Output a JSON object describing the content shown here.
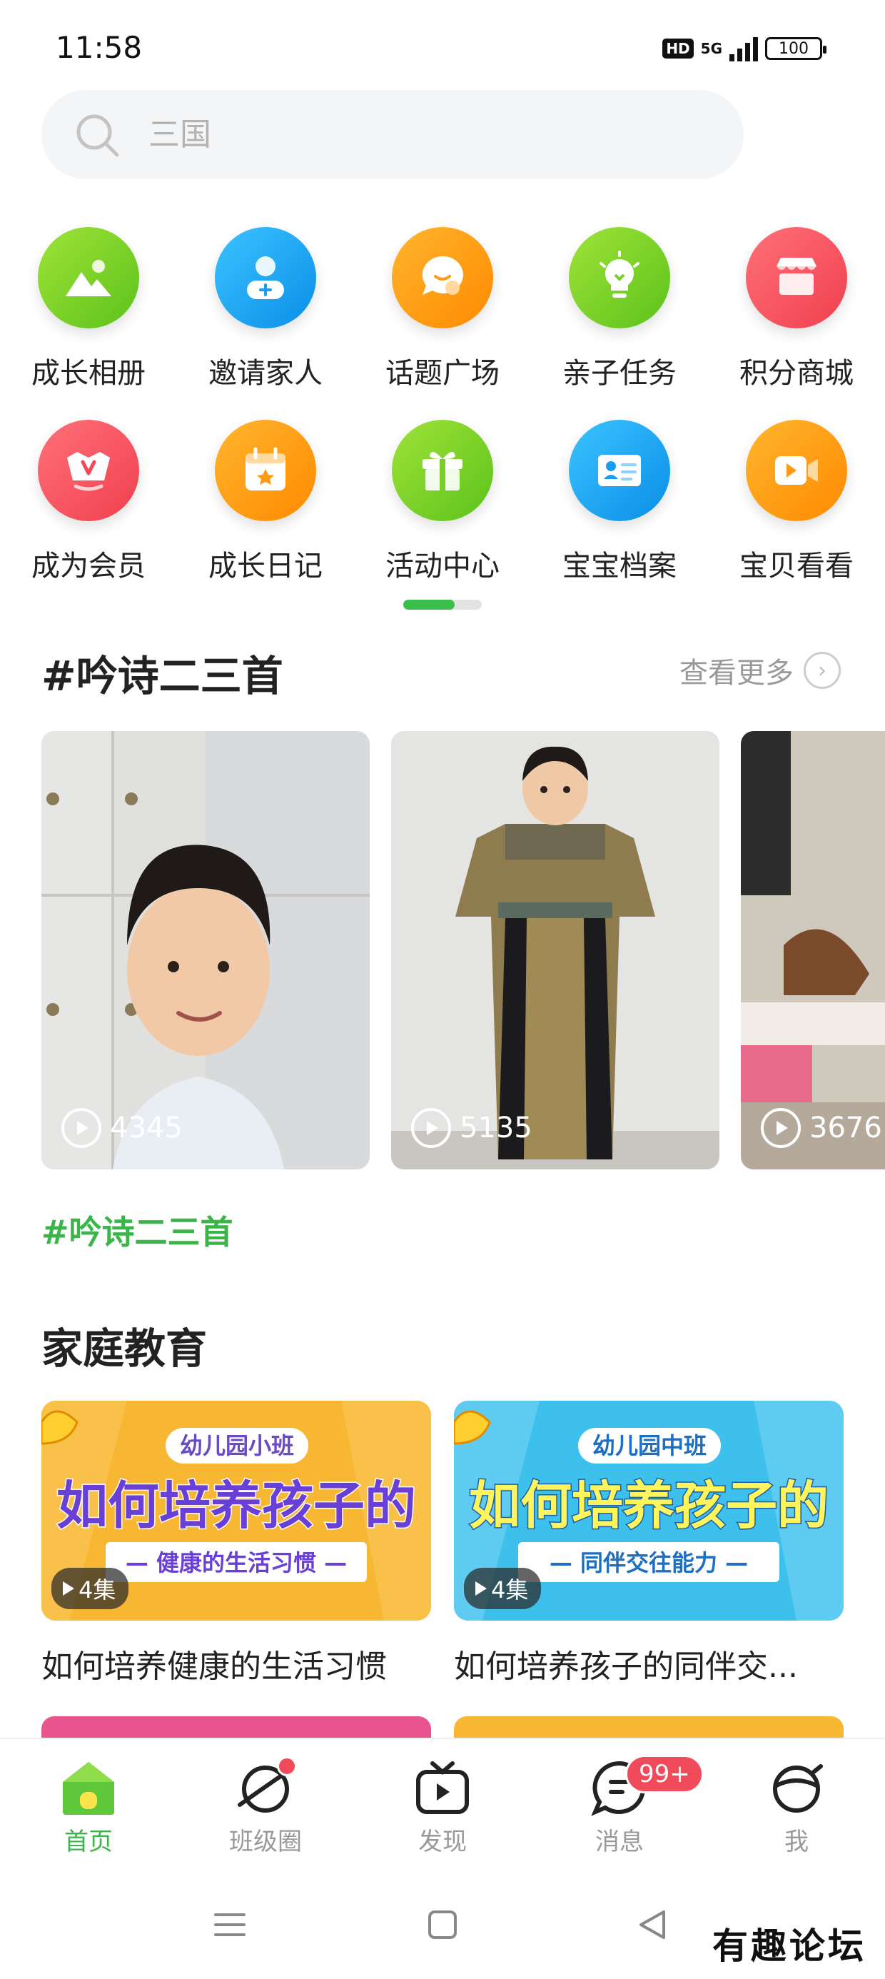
{
  "status": {
    "time": "11:58",
    "hd": "HD",
    "network": "5G",
    "battery": "100"
  },
  "search": {
    "placeholder": "三国"
  },
  "quick_grid": [
    {
      "label": "成长相册",
      "icon": "photo-album-icon",
      "color": "#7ed321"
    },
    {
      "label": "邀请家人",
      "icon": "invite-person-icon",
      "color": "#1aa7f5"
    },
    {
      "label": "话题广场",
      "icon": "chat-bubble-icon",
      "color": "#ff9f0a"
    },
    {
      "label": "亲子任务",
      "icon": "lightbulb-icon",
      "color": "#7ed321"
    },
    {
      "label": "积分商城",
      "icon": "store-icon",
      "color": "#f7525f"
    },
    {
      "label": "成为会员",
      "icon": "vip-crown-icon",
      "color": "#f7525f"
    },
    {
      "label": "成长日记",
      "icon": "calendar-star-icon",
      "color": "#ff9f0a"
    },
    {
      "label": "活动中心",
      "icon": "gift-icon",
      "color": "#7ed321"
    },
    {
      "label": "宝宝档案",
      "icon": "profile-card-icon",
      "color": "#1aa7f5"
    },
    {
      "label": "宝贝看看",
      "icon": "video-camera-icon",
      "color": "#ff9f0a"
    }
  ],
  "section1": {
    "title": "#吟诗二三首",
    "see_more": "查看更多",
    "videos": [
      {
        "plays": "4345"
      },
      {
        "plays": "5135"
      },
      {
        "plays": "3676"
      }
    ],
    "hashtag": "#吟诗二三首"
  },
  "section2": {
    "title": "家庭教育",
    "courses": [
      {
        "tag": "幼儿园小班",
        "headline": "如何培养孩子的",
        "sub": "— 健康的生活习惯 —",
        "episodes": "4集",
        "title": "如何培养健康的生活习惯"
      },
      {
        "tag": "幼儿园中班",
        "headline": "如何培养孩子的",
        "sub": "— 同伴交往能力 —",
        "episodes": "4集",
        "title": "如何培养孩子的同伴交..."
      }
    ]
  },
  "tabs": [
    {
      "label": "首页",
      "icon": "home-icon"
    },
    {
      "label": "班级圈",
      "icon": "planet-icon"
    },
    {
      "label": "发现",
      "icon": "tv-play-icon"
    },
    {
      "label": "消息",
      "icon": "message-icon",
      "badge": "99+"
    },
    {
      "label": "我",
      "icon": "profile-face-icon"
    }
  ],
  "watermark": "有趣论坛",
  "colors": {
    "accent": "#3bb54a",
    "badge": "#f04b5a"
  }
}
